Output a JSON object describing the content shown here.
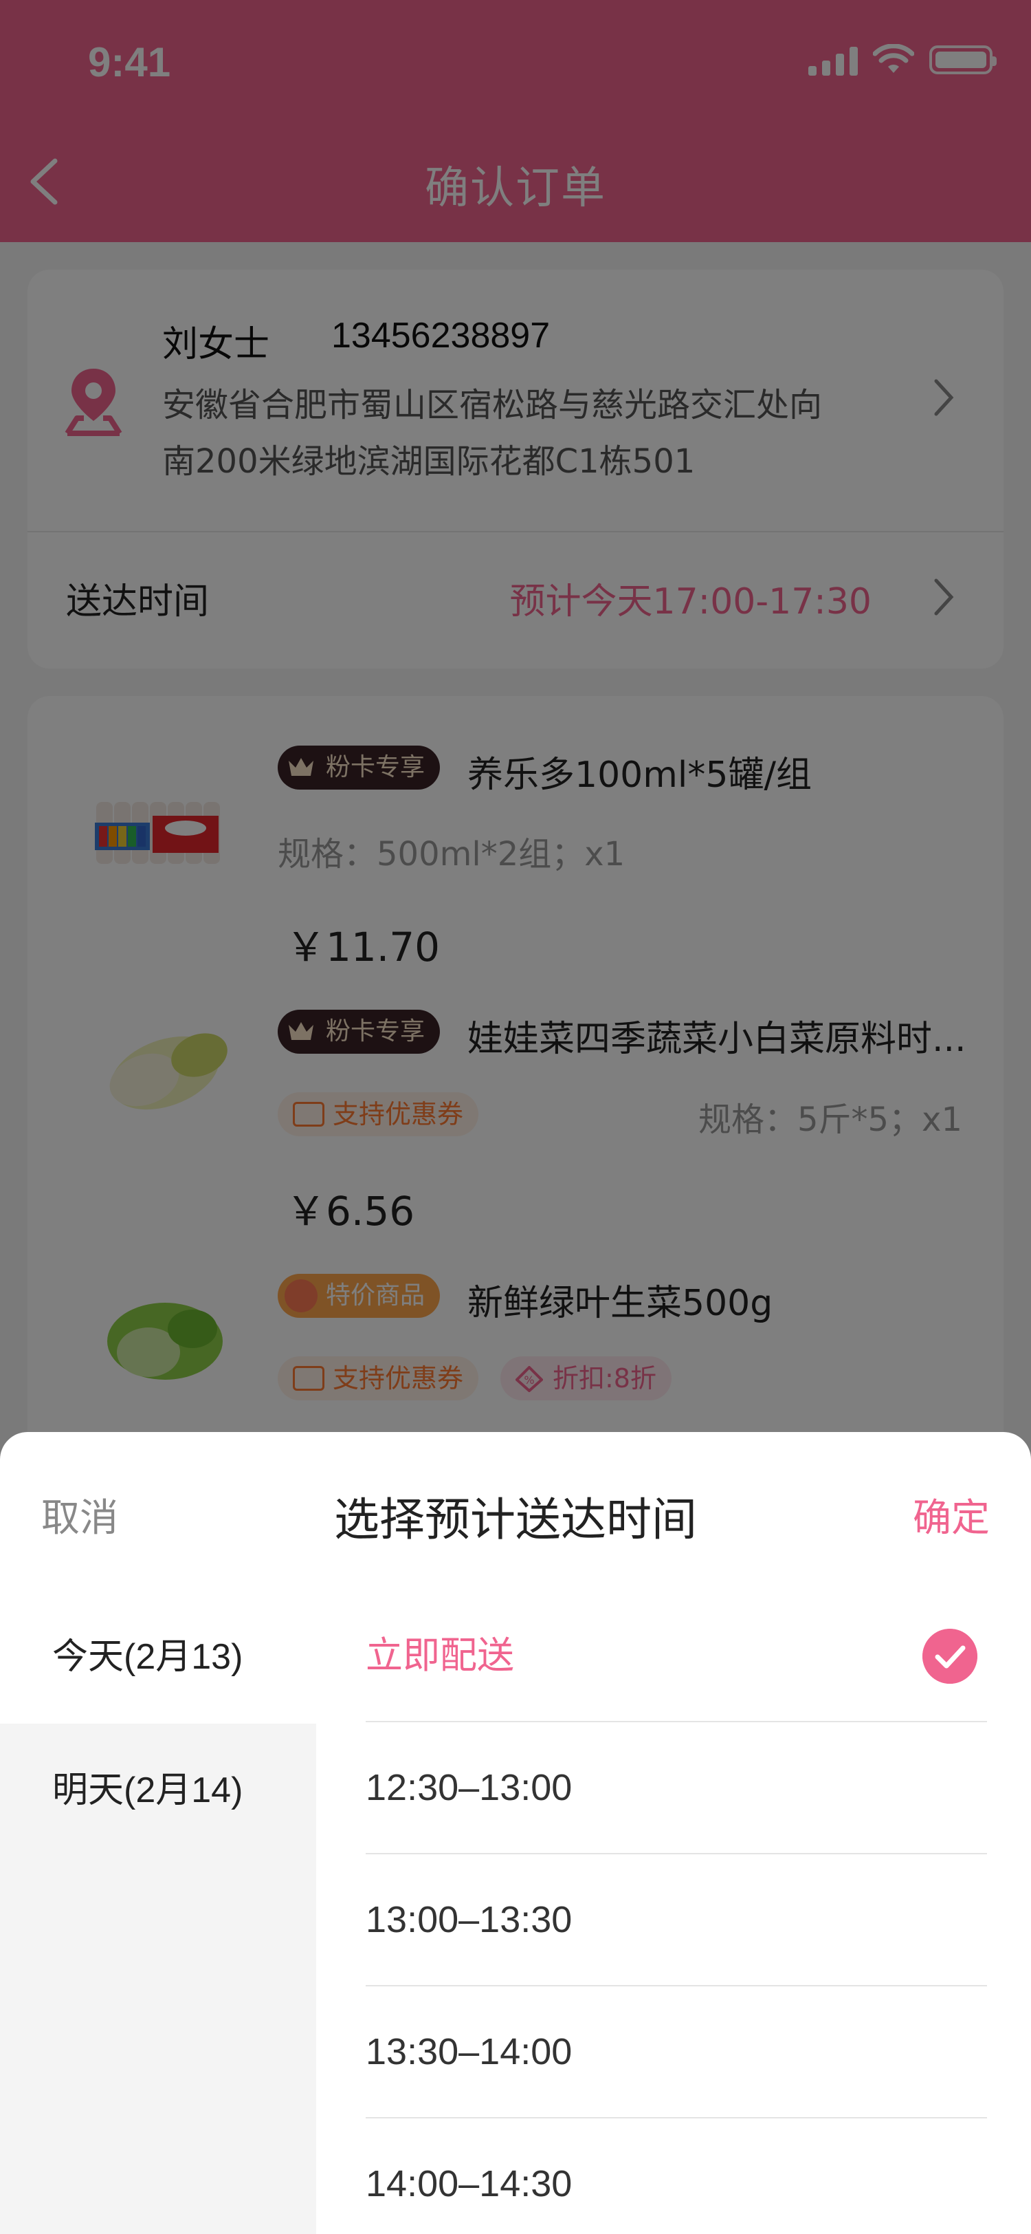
{
  "status_bar": {
    "time": "9:41"
  },
  "nav": {
    "title": "确认订单"
  },
  "address": {
    "name": "刘女士",
    "phone": "13456238897",
    "line1": "安徽省合肥市蜀山区宿松路与慈光路交汇处向",
    "line2": "南200米绿地滨湖国际花都C1栋501"
  },
  "delivery": {
    "label": "送达时间",
    "value": "预计今天17:00-17:30"
  },
  "products": [
    {
      "badge": "粉卡专享",
      "name": "养乐多100ml*5罐/组",
      "spec": "规格：500ml*2组；x1",
      "price": "￥11.70"
    },
    {
      "badge": "粉卡专享",
      "name": "娃娃菜四季蔬菜小白菜原料时...",
      "coupon": "支持优惠券",
      "spec": "规格：5斤*5；x1",
      "price": "￥6.56"
    },
    {
      "badge": "特价商品",
      "name": "新鲜绿叶生菜500g",
      "coupon": "支持优惠券",
      "discount": "折扣:8折"
    }
  ],
  "sheet": {
    "cancel": "取消",
    "title": "选择预计送达时间",
    "confirm": "确定",
    "days": [
      {
        "label": "今天(2月13)",
        "active": true
      },
      {
        "label": "明天(2月14)",
        "active": false
      }
    ],
    "slots": [
      {
        "label": "立即配送",
        "selected": true
      },
      {
        "label": "12:30–13:00",
        "selected": false
      },
      {
        "label": "13:00–13:30",
        "selected": false
      },
      {
        "label": "13:30–14:00",
        "selected": false
      },
      {
        "label": "14:00–14:30",
        "selected": false
      }
    ]
  },
  "colors": {
    "accent": "#f0648f",
    "dim_overlay": "rgba(0,0,0,0.5)"
  }
}
